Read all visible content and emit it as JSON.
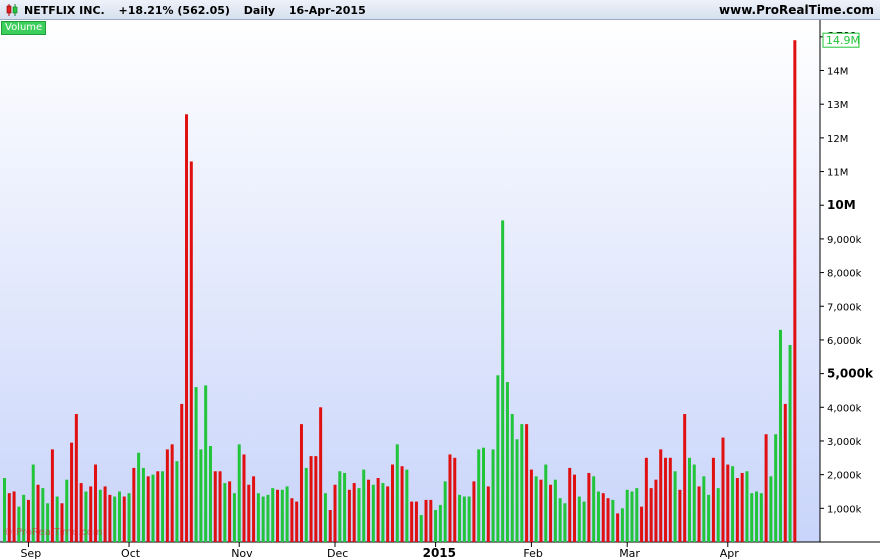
{
  "header": {
    "symbol": "NETFLIX INC.",
    "change": "+18.21% (562.05)",
    "period": "Daily",
    "date": "16-Apr-2015",
    "site": "www.ProRealTime.com"
  },
  "indicator_label": "Volume",
  "watermark": "© ProRealTime.com",
  "colors": {
    "up": "#22c43a",
    "down": "#e01010",
    "background_top": "#ffffff",
    "background_bottom": "#c8d4fa",
    "last_value_box": "#22c43a"
  },
  "chart_data": {
    "type": "bar",
    "title": "",
    "xlabel": "",
    "ylabel": "Volume",
    "ylim": [
      0,
      15500000
    ],
    "grid": false,
    "y_ticks": [
      {
        "value": 1000000,
        "label": "1,000k",
        "bold": false
      },
      {
        "value": 2000000,
        "label": "2,000k",
        "bold": false
      },
      {
        "value": 3000000,
        "label": "3,000k",
        "bold": false
      },
      {
        "value": 4000000,
        "label": "4,000k",
        "bold": false
      },
      {
        "value": 5000000,
        "label": "5,000k",
        "bold": true
      },
      {
        "value": 6000000,
        "label": "6,000k",
        "bold": false
      },
      {
        "value": 7000000,
        "label": "7,000k",
        "bold": false
      },
      {
        "value": 8000000,
        "label": "8,000k",
        "bold": false
      },
      {
        "value": 9000000,
        "label": "9,000k",
        "bold": false
      },
      {
        "value": 10000000,
        "label": "10M",
        "bold": true
      },
      {
        "value": 11000000,
        "label": "11M",
        "bold": false
      },
      {
        "value": 12000000,
        "label": "12M",
        "bold": false
      },
      {
        "value": 13000000,
        "label": "13M",
        "bold": false
      },
      {
        "value": 14000000,
        "label": "14M",
        "bold": false
      },
      {
        "value": 15000000,
        "label": "15M",
        "bold": true
      }
    ],
    "last_value_label": "14.9M",
    "x_labels": [
      {
        "index": 5,
        "label": "Sep",
        "bold": false
      },
      {
        "index": 26,
        "label": "Oct",
        "bold": false
      },
      {
        "index": 49,
        "label": "Nov",
        "bold": false
      },
      {
        "index": 69,
        "label": "Dec",
        "bold": false
      },
      {
        "index": 90,
        "label": "2015",
        "bold": true
      },
      {
        "index": 110,
        "label": "Feb",
        "bold": false
      },
      {
        "index": 130,
        "label": "Mar",
        "bold": false
      },
      {
        "index": 151,
        "label": "Apr",
        "bold": false
      }
    ],
    "series": [
      {
        "values": [
          1.9,
          1.45,
          1.5,
          1.05,
          1.4,
          1.25,
          2.3,
          1.7,
          1.6,
          1.15,
          2.75,
          1.35,
          1.15,
          1.85,
          2.95,
          3.8,
          1.75,
          1.5,
          1.65,
          2.3,
          1.55,
          1.65,
          1.4,
          1.35,
          1.5,
          1.35,
          1.45,
          2.2,
          2.65,
          2.2,
          1.95,
          2.0,
          2.1,
          2.1,
          2.75,
          2.9,
          2.4,
          4.1,
          12.7,
          11.3,
          4.6,
          2.75,
          4.65,
          2.85,
          2.1,
          2.1,
          1.75,
          1.8,
          1.45,
          2.9,
          2.6,
          1.7,
          1.95,
          1.45,
          1.35,
          1.4,
          1.6,
          1.55,
          1.55,
          1.65,
          1.3,
          1.2,
          3.5,
          2.2,
          2.55,
          2.55,
          4.0,
          1.45,
          0.95,
          1.7,
          2.1,
          2.05,
          1.55,
          1.75,
          1.6,
          2.15,
          1.85,
          1.7,
          1.9,
          1.75,
          1.65,
          2.3,
          2.9,
          2.25,
          2.15,
          1.2,
          1.2,
          0.8,
          1.25,
          1.25,
          0.95,
          1.1,
          1.8,
          2.6,
          2.5,
          1.4,
          1.35,
          1.35,
          1.8,
          2.75,
          2.8,
          1.65,
          2.75,
          4.95,
          9.55,
          4.75,
          3.8,
          3.05,
          3.5,
          3.5,
          2.15,
          1.95,
          1.85,
          2.3,
          1.7,
          1.85,
          1.3,
          1.15,
          2.2,
          2.0,
          1.35,
          1.2,
          2.05,
          1.95,
          1.5,
          1.45,
          1.3,
          1.25,
          0.85,
          1.0,
          1.55,
          1.5,
          1.6,
          1.05,
          2.5,
          1.6,
          1.85,
          2.75,
          2.5,
          2.5,
          2.1,
          1.55,
          3.8,
          2.5,
          2.3,
          1.65,
          1.95,
          1.4,
          2.5,
          1.6,
          3.1,
          2.3,
          2.25,
          1.9,
          2.05,
          2.1,
          1.45,
          1.5,
          1.45,
          3.2,
          1.95,
          3.2,
          6.3,
          4.1,
          5.85,
          14.9
        ],
        "colors": [
          "g",
          "r",
          "r",
          "g",
          "g",
          "r",
          "g",
          "r",
          "g",
          "g",
          "r",
          "g",
          "r",
          "g",
          "r",
          "r",
          "r",
          "g",
          "r",
          "r",
          "g",
          "r",
          "r",
          "g",
          "g",
          "r",
          "g",
          "r",
          "g",
          "g",
          "r",
          "g",
          "r",
          "g",
          "r",
          "r",
          "g",
          "r",
          "r",
          "r",
          "g",
          "g",
          "g",
          "g",
          "r",
          "r",
          "g",
          "r",
          "g",
          "g",
          "r",
          "r",
          "r",
          "g",
          "g",
          "g",
          "g",
          "r",
          "g",
          "g",
          "r",
          "r",
          "r",
          "g",
          "r",
          "r",
          "r",
          "g",
          "r",
          "r",
          "g",
          "g",
          "r",
          "r",
          "g",
          "g",
          "r",
          "g",
          "r",
          "g",
          "r",
          "r",
          "g",
          "r",
          "g",
          "r",
          "r",
          "g",
          "r",
          "r",
          "g",
          "g",
          "g",
          "r",
          "r",
          "g",
          "g",
          "g",
          "r",
          "g",
          "g",
          "r",
          "g",
          "g",
          "g",
          "g",
          "g",
          "g",
          "g",
          "r",
          "r",
          "g",
          "r",
          "g",
          "r",
          "g",
          "g",
          "g",
          "r",
          "r",
          "g",
          "g",
          "r",
          "g",
          "g",
          "r",
          "r",
          "g",
          "r",
          "g",
          "g",
          "g",
          "g",
          "r",
          "r",
          "r",
          "r",
          "r",
          "r",
          "r",
          "g",
          "r",
          "r",
          "g",
          "g",
          "r",
          "g",
          "g",
          "r",
          "g",
          "r",
          "r",
          "g",
          "r",
          "r",
          "g",
          "g",
          "g",
          "g",
          "r",
          "g",
          "g",
          "g",
          "r",
          "g"
        ],
        "unit": "millions"
      }
    ]
  }
}
